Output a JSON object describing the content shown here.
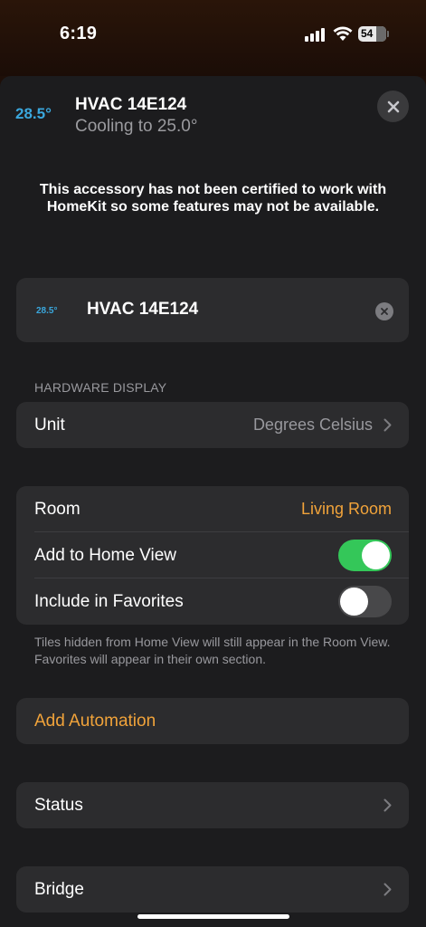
{
  "status_bar": {
    "time": "6:19",
    "battery": "54",
    "battery_fraction": 0.54
  },
  "header": {
    "current_temp": "28.5°",
    "title": "HVAC 14E124",
    "subtitle": "Cooling to 25.0°",
    "close_icon": "xmark-icon"
  },
  "warning_text": "This accessory has not been certified to work with HomeKit so some features may not be available.",
  "name_card": {
    "temp": "28.5°",
    "name": "HVAC 14E124",
    "clear_icon": "clear-icon"
  },
  "hardware_display": {
    "section_label": "HARDWARE DISPLAY",
    "unit_label": "Unit",
    "unit_value": "Degrees Celsius"
  },
  "settings": {
    "room_label": "Room",
    "room_value": "Living Room",
    "home_view_label": "Add to Home View",
    "home_view_on": true,
    "favorites_label": "Include in Favorites",
    "favorites_on": false
  },
  "footnote": "Tiles hidden from Home View will still appear in the Room View. Favorites will appear in their own section.",
  "automation": {
    "label": "Add Automation"
  },
  "status": {
    "label": "Status"
  },
  "bridge": {
    "label": "Bridge"
  },
  "colors": {
    "accent_orange": "#f1a33a",
    "temp_blue": "#3aa7dd",
    "toggle_green": "#34c759"
  }
}
